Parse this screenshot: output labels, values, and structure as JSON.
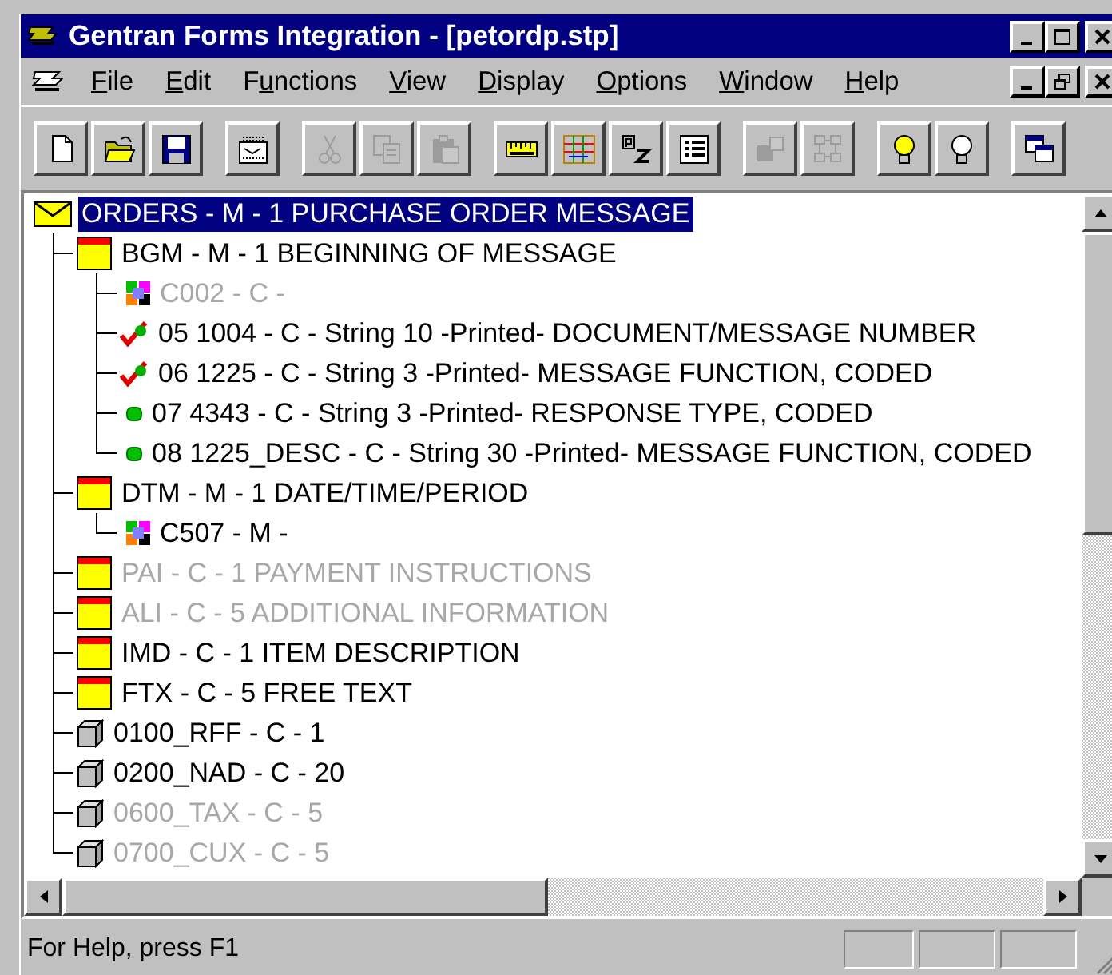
{
  "window": {
    "title": "Gentran Forms Integration - [petordp.stp]"
  },
  "menu": [
    {
      "access_key": "F",
      "label_rest": "ile"
    },
    {
      "access_key": "E",
      "label_rest": "dit"
    },
    {
      "label_start": "F",
      "access_key": "u",
      "label_rest": "nctions"
    },
    {
      "access_key": "V",
      "label_rest": "iew"
    },
    {
      "access_key": "D",
      "label_rest": "isplay"
    },
    {
      "access_key": "O",
      "label_rest": "ptions"
    },
    {
      "access_key": "W",
      "label_rest": "indow"
    },
    {
      "access_key": "H",
      "label_rest": "elp"
    }
  ],
  "toolbar_groups": [
    {
      "buttons": [
        {
          "kind": "new",
          "disabled": false
        },
        {
          "kind": "open",
          "disabled": false
        },
        {
          "kind": "save",
          "disabled": false
        }
      ]
    },
    {
      "buttons": [
        {
          "kind": "form",
          "disabled": false
        }
      ]
    },
    {
      "buttons": [
        {
          "kind": "cut",
          "disabled": true
        },
        {
          "kind": "copy",
          "disabled": true
        },
        {
          "kind": "paste",
          "disabled": true
        }
      ]
    },
    {
      "buttons": [
        {
          "kind": "ruler",
          "disabled": false
        },
        {
          "kind": "grid",
          "disabled": false
        },
        {
          "kind": "sort",
          "disabled": false
        },
        {
          "kind": "list",
          "disabled": false
        }
      ]
    },
    {
      "buttons": [
        {
          "kind": "blocks",
          "disabled": true
        },
        {
          "kind": "network",
          "disabled": true
        }
      ]
    },
    {
      "buttons": [
        {
          "kind": "bulb_on",
          "disabled": false
        },
        {
          "kind": "bulb_off",
          "disabled": false
        }
      ]
    },
    {
      "buttons": [
        {
          "kind": "windows",
          "disabled": false
        }
      ]
    }
  ],
  "tree": [
    {
      "kind": "message",
      "label": "ORDERS - M -  1 PURCHASE ORDER MESSAGE",
      "selected": true,
      "disabled": false,
      "children": [
        {
          "kind": "segment",
          "label": "BGM - M -  1 BEGINNING OF MESSAGE",
          "selected": false,
          "disabled": false,
          "children": [
            {
              "kind": "composite",
              "label": "C002 - C -",
              "selected": false,
              "disabled": true
            },
            {
              "kind": "mapped_element",
              "label": "05 1004 - C - String 10 -Printed- DOCUMENT/MESSAGE NUMBER",
              "selected": false,
              "disabled": false
            },
            {
              "kind": "mapped_element",
              "label": "06 1225 - C - String 3 -Printed- MESSAGE FUNCTION, CODED",
              "selected": false,
              "disabled": false
            },
            {
              "kind": "element",
              "label": "07 4343 - C - String 3 -Printed- RESPONSE TYPE, CODED",
              "selected": false,
              "disabled": false
            },
            {
              "kind": "element",
              "label": "08 1225_DESC - C - String 30 -Printed- MESSAGE FUNCTION, CODED",
              "selected": false,
              "disabled": false
            }
          ]
        },
        {
          "kind": "segment",
          "label": "DTM - M -  1 DATE/TIME/PERIOD",
          "selected": false,
          "disabled": false,
          "children": [
            {
              "kind": "composite",
              "label": "C507 - M -",
              "selected": false,
              "disabled": false
            }
          ]
        },
        {
          "kind": "segment",
          "label": "PAI - C -  1 PAYMENT INSTRUCTIONS",
          "selected": false,
          "disabled": true
        },
        {
          "kind": "segment",
          "label": "ALI - C -  5 ADDITIONAL INFORMATION",
          "selected": false,
          "disabled": true
        },
        {
          "kind": "segment",
          "label": "IMD - C -  1 ITEM DESCRIPTION",
          "selected": false,
          "disabled": false
        },
        {
          "kind": "segment",
          "label": "FTX - C -  5 FREE TEXT",
          "selected": false,
          "disabled": false
        },
        {
          "kind": "group",
          "label": "0100_RFF - C -  1",
          "selected": false,
          "disabled": false
        },
        {
          "kind": "group",
          "label": "0200_NAD - C -  20",
          "selected": false,
          "disabled": false
        },
        {
          "kind": "group",
          "label": "0600_TAX - C -  5",
          "selected": false,
          "disabled": true
        },
        {
          "kind": "group",
          "label": "0700_CUX - C -  5",
          "selected": false,
          "disabled": true
        }
      ]
    }
  ],
  "status_bar": {
    "text": "For Help, press F1"
  }
}
